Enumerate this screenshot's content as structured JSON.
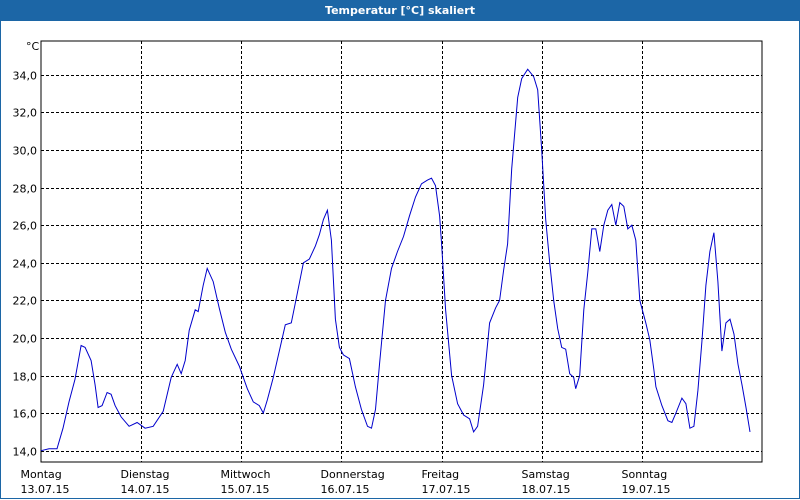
{
  "window": {
    "title": "Temperatur [°C] skaliert"
  },
  "colors": {
    "titlebar": "#1c66a6",
    "line": "#0000cc",
    "grid": "#000000"
  },
  "chart_data": {
    "type": "line",
    "title": "Temperatur [°C] skaliert",
    "ylabel": "°C",
    "xlabel": "",
    "ylim": [
      13.4,
      35.8
    ],
    "y_ticks": [
      {
        "value": 14,
        "label": "14,0"
      },
      {
        "value": 16,
        "label": "16,0"
      },
      {
        "value": 18,
        "label": "18,0"
      },
      {
        "value": 20,
        "label": "20,0"
      },
      {
        "value": 22,
        "label": "22,0"
      },
      {
        "value": 24,
        "label": "24,0"
      },
      {
        "value": 26,
        "label": "26,0"
      },
      {
        "value": 28,
        "label": "28,0"
      },
      {
        "value": 30,
        "label": "30,0"
      },
      {
        "value": 32,
        "label": "32,0"
      },
      {
        "value": 34,
        "label": "34,0"
      }
    ],
    "x_unit": "days since 13.07.15 00:00",
    "xlim": [
      0,
      7.2
    ],
    "x_ticks": [
      {
        "value": 0,
        "day": "Montag",
        "date": "13.07.15"
      },
      {
        "value": 1,
        "day": "Dienstag",
        "date": "14.07.15"
      },
      {
        "value": 2,
        "day": "Mittwoch",
        "date": "15.07.15"
      },
      {
        "value": 3,
        "day": "Donnerstag",
        "date": "16.07.15"
      },
      {
        "value": 4,
        "day": "Freitag",
        "date": "17.07.15"
      },
      {
        "value": 5,
        "day": "Samstag",
        "date": "18.07.15"
      },
      {
        "value": 6,
        "day": "Sonntag",
        "date": "19.07.15"
      }
    ],
    "grid": true,
    "series": [
      {
        "points": [
          [
            0.0,
            14.0
          ],
          [
            0.08,
            14.1
          ],
          [
            0.16,
            14.1
          ],
          [
            0.22,
            15.2
          ],
          [
            0.28,
            16.6
          ],
          [
            0.34,
            17.8
          ],
          [
            0.4,
            19.6
          ],
          [
            0.44,
            19.5
          ],
          [
            0.5,
            18.8
          ],
          [
            0.54,
            17.5
          ],
          [
            0.57,
            16.3
          ],
          [
            0.61,
            16.4
          ],
          [
            0.66,
            17.1
          ],
          [
            0.7,
            17.0
          ],
          [
            0.74,
            16.4
          ],
          [
            0.8,
            15.8
          ],
          [
            0.88,
            15.3
          ],
          [
            0.96,
            15.5
          ],
          [
            1.04,
            15.2
          ],
          [
            1.12,
            15.3
          ],
          [
            1.22,
            16.1
          ],
          [
            1.3,
            17.9
          ],
          [
            1.36,
            18.6
          ],
          [
            1.4,
            18.1
          ],
          [
            1.44,
            18.8
          ],
          [
            1.48,
            20.4
          ],
          [
            1.54,
            21.5
          ],
          [
            1.57,
            21.4
          ],
          [
            1.62,
            22.8
          ],
          [
            1.66,
            23.7
          ],
          [
            1.72,
            23.0
          ],
          [
            1.78,
            21.6
          ],
          [
            1.84,
            20.3
          ],
          [
            1.9,
            19.4
          ],
          [
            1.98,
            18.5
          ],
          [
            2.06,
            17.3
          ],
          [
            2.12,
            16.6
          ],
          [
            2.18,
            16.4
          ],
          [
            2.22,
            16.0
          ],
          [
            2.26,
            16.7
          ],
          [
            2.32,
            17.9
          ],
          [
            2.38,
            19.3
          ],
          [
            2.44,
            20.7
          ],
          [
            2.5,
            20.8
          ],
          [
            2.56,
            22.4
          ],
          [
            2.62,
            24.0
          ],
          [
            2.68,
            24.2
          ],
          [
            2.74,
            24.9
          ],
          [
            2.78,
            25.5
          ],
          [
            2.82,
            26.3
          ],
          [
            2.86,
            26.8
          ],
          [
            2.9,
            25.2
          ],
          [
            2.94,
            21.0
          ],
          [
            2.98,
            19.5
          ],
          [
            3.02,
            19.1
          ],
          [
            3.08,
            18.9
          ],
          [
            3.14,
            17.4
          ],
          [
            3.2,
            16.2
          ],
          [
            3.26,
            15.3
          ],
          [
            3.3,
            15.2
          ],
          [
            3.34,
            16.2
          ],
          [
            3.38,
            18.6
          ],
          [
            3.44,
            22.0
          ],
          [
            3.5,
            23.7
          ],
          [
            3.56,
            24.6
          ],
          [
            3.62,
            25.4
          ],
          [
            3.68,
            26.5
          ],
          [
            3.74,
            27.5
          ],
          [
            3.8,
            28.2
          ],
          [
            3.86,
            28.4
          ],
          [
            3.9,
            28.5
          ],
          [
            3.94,
            28.1
          ],
          [
            3.98,
            26.5
          ],
          [
            4.0,
            25.0
          ],
          [
            4.04,
            21.5
          ],
          [
            4.1,
            18.0
          ],
          [
            4.16,
            16.5
          ],
          [
            4.22,
            15.9
          ],
          [
            4.28,
            15.7
          ],
          [
            4.32,
            15.0
          ],
          [
            4.36,
            15.3
          ],
          [
            4.42,
            17.5
          ],
          [
            4.48,
            20.8
          ],
          [
            4.54,
            21.6
          ],
          [
            4.58,
            22.0
          ],
          [
            4.62,
            23.6
          ],
          [
            4.66,
            25.0
          ],
          [
            4.7,
            29.0
          ],
          [
            4.76,
            32.8
          ],
          [
            4.8,
            33.8
          ],
          [
            4.86,
            34.3
          ],
          [
            4.92,
            33.9
          ],
          [
            4.96,
            33.2
          ],
          [
            5.0,
            30.0
          ],
          [
            5.04,
            26.3
          ],
          [
            5.08,
            24.0
          ],
          [
            5.12,
            22.0
          ],
          [
            5.16,
            20.5
          ],
          [
            5.2,
            19.5
          ],
          [
            5.24,
            19.4
          ],
          [
            5.28,
            18.1
          ],
          [
            5.32,
            17.9
          ],
          [
            5.34,
            17.3
          ],
          [
            5.38,
            18.0
          ],
          [
            5.42,
            21.5
          ],
          [
            5.46,
            23.5
          ],
          [
            5.5,
            25.8
          ],
          [
            5.54,
            25.8
          ],
          [
            5.58,
            24.6
          ],
          [
            5.62,
            26.0
          ],
          [
            5.66,
            26.8
          ],
          [
            5.7,
            27.1
          ],
          [
            5.74,
            26.0
          ],
          [
            5.78,
            27.2
          ],
          [
            5.82,
            27.0
          ],
          [
            5.86,
            25.8
          ],
          [
            5.9,
            26.0
          ],
          [
            5.94,
            25.2
          ],
          [
            5.98,
            22.0
          ],
          [
            6.04,
            20.8
          ],
          [
            6.08,
            19.9
          ],
          [
            6.12,
            18.3
          ],
          [
            6.14,
            17.4
          ],
          [
            6.2,
            16.4
          ],
          [
            6.26,
            15.6
          ],
          [
            6.3,
            15.5
          ],
          [
            6.34,
            16.0
          ],
          [
            6.4,
            16.8
          ],
          [
            6.44,
            16.5
          ],
          [
            6.48,
            15.2
          ],
          [
            6.52,
            15.3
          ],
          [
            6.56,
            17.2
          ],
          [
            6.6,
            19.8
          ],
          [
            6.64,
            22.8
          ],
          [
            6.68,
            24.6
          ],
          [
            6.72,
            25.6
          ],
          [
            6.76,
            23.0
          ],
          [
            6.8,
            19.3
          ],
          [
            6.84,
            20.8
          ],
          [
            6.88,
            21.0
          ],
          [
            6.92,
            20.2
          ],
          [
            6.96,
            18.6
          ],
          [
            7.0,
            17.5
          ],
          [
            7.04,
            16.3
          ],
          [
            7.08,
            15.0
          ]
        ]
      }
    ]
  }
}
